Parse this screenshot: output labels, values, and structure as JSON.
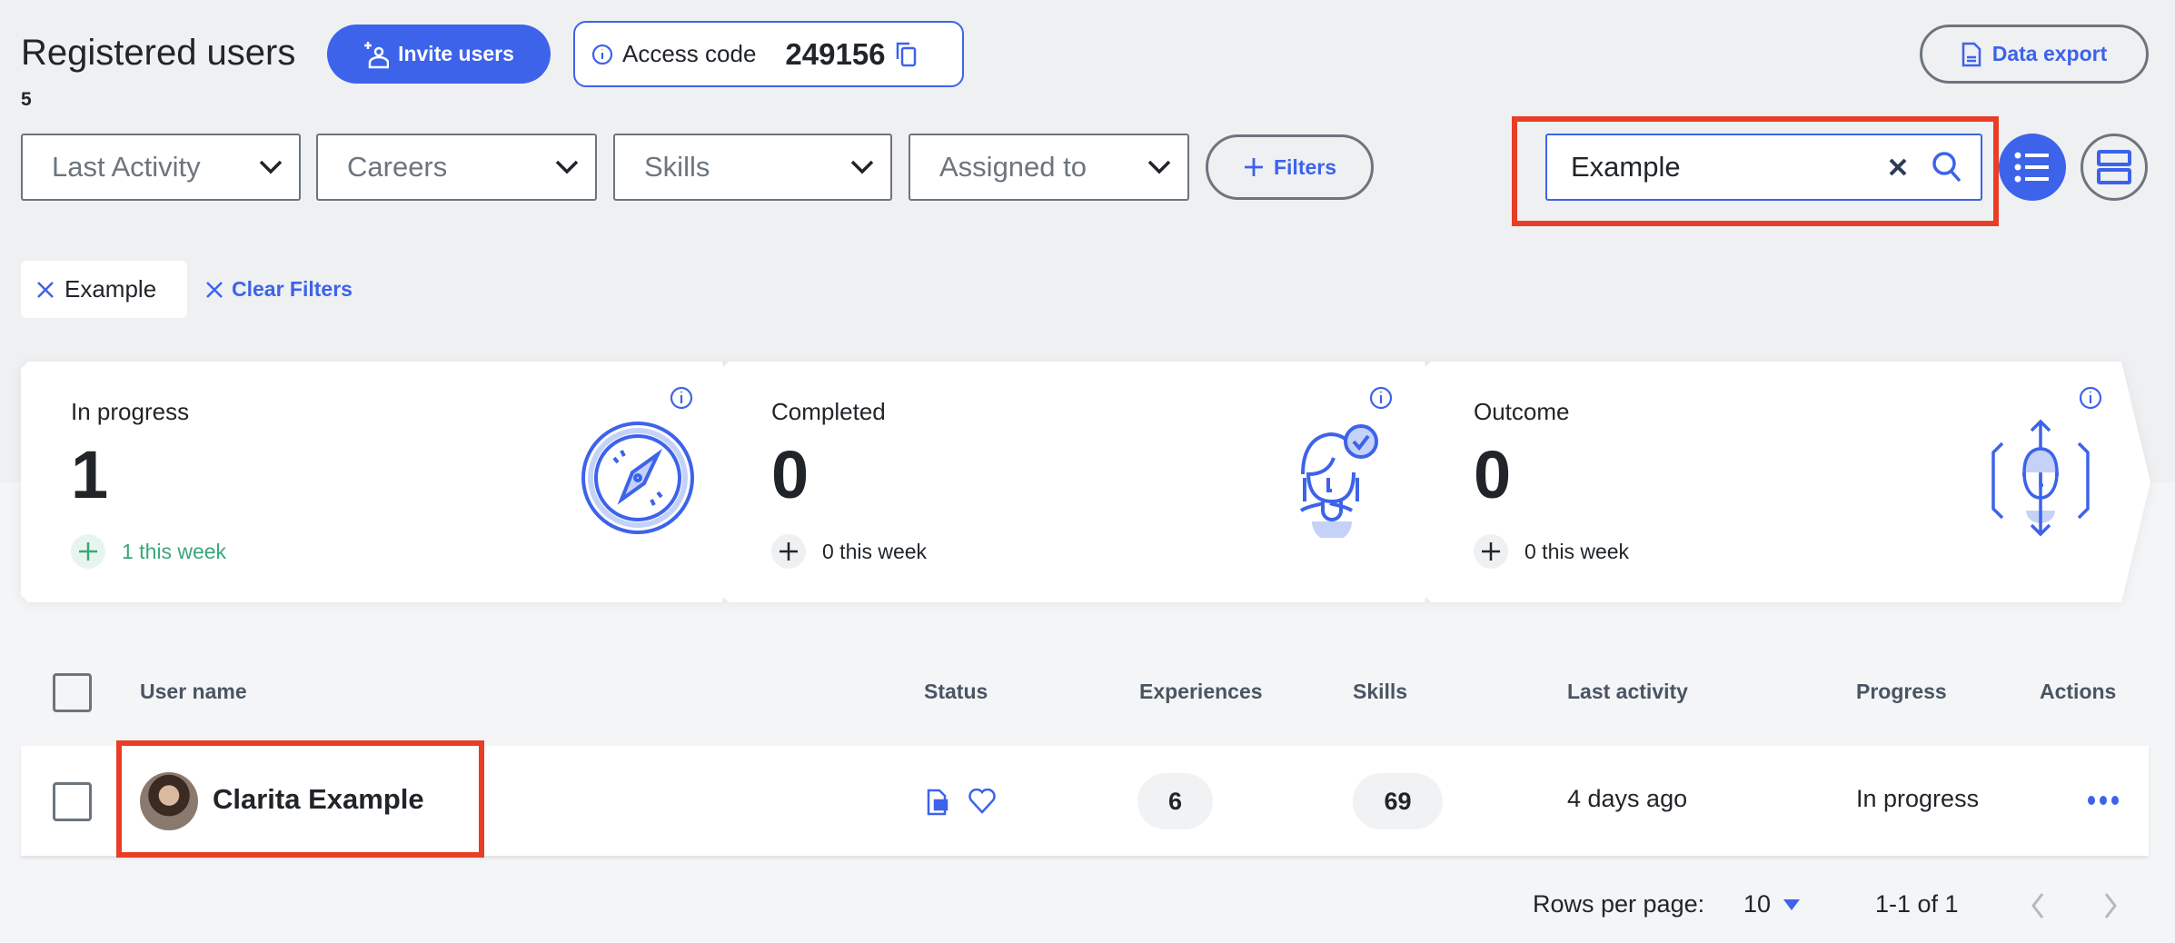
{
  "header": {
    "title": "Registered users",
    "count": "5",
    "invite_label": "Invite users",
    "access_code_label": "Access code",
    "access_code": "249156",
    "export_label": "Data export"
  },
  "filters": {
    "dropdowns": [
      {
        "label": "Last Activity"
      },
      {
        "label": "Careers"
      },
      {
        "label": "Skills"
      },
      {
        "label": "Assigned to"
      }
    ],
    "more_label": "Filters"
  },
  "search": {
    "value": "Example"
  },
  "active_filters": {
    "chip": "Example",
    "clear_label": "Clear Filters"
  },
  "stats": [
    {
      "label": "In progress",
      "value": "1",
      "week": "1 this week",
      "icon": "compass-icon"
    },
    {
      "label": "Completed",
      "value": "0",
      "week": "0 this week",
      "icon": "person-check-icon"
    },
    {
      "label": "Outcome",
      "value": "0",
      "week": "0 this week",
      "icon": "person-expand-icon"
    }
  ],
  "table": {
    "columns": [
      "User name",
      "Status",
      "Experiences",
      "Skills",
      "Last activity",
      "Progress",
      "Actions"
    ],
    "rows": [
      {
        "name": "Clarita Example",
        "experiences": "6",
        "skills": "69",
        "last_activity": "4 days ago",
        "progress": "In progress"
      }
    ]
  },
  "pagination": {
    "rows_label": "Rows per page:",
    "rows_value": "10",
    "range": "1-1 of 1"
  },
  "colors": {
    "accent": "#3d63ea",
    "positive": "#3aa776",
    "highlight": "#e83e26"
  }
}
